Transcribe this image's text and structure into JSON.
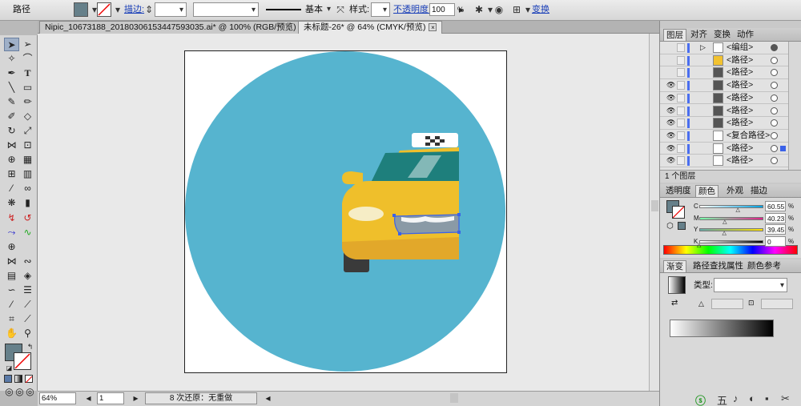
{
  "control_bar": {
    "object_type": "路径",
    "fill_color": "#66808a",
    "stroke_label": "描边:",
    "stroke_style_label": "基本",
    "style_label": "样式:",
    "opacity_label": "不透明度:",
    "opacity_value": "100",
    "opacity_unit": "%",
    "transform_link": "变换"
  },
  "doc_tabs": [
    {
      "label": "Nipic_10673188_20180306153447593035.ai* @ 100% (RGB/预览)",
      "active": false
    },
    {
      "label": "未标题-26* @ 64% (CMYK/预览)",
      "active": true
    }
  ],
  "tab_close": "×",
  "status_bar": {
    "zoom": "64%",
    "page": "1",
    "undo_info": "8 次还原：无重做"
  },
  "layers_panel": {
    "tabs": [
      "图层",
      "对齐",
      "变换",
      "动作"
    ],
    "rows": [
      {
        "name": "<编组>",
        "visible": false,
        "thumb": "#ffffff"
      },
      {
        "name": "<路径>",
        "visible": false,
        "thumb": "#f2c230"
      },
      {
        "name": "<路径>",
        "visible": false,
        "thumb": "#555555"
      },
      {
        "name": "<路径>",
        "visible": true,
        "thumb": "#555555"
      },
      {
        "name": "<路径>",
        "visible": true,
        "thumb": "#555555"
      },
      {
        "name": "<路径>",
        "visible": true,
        "thumb": "#555555"
      },
      {
        "name": "<路径>",
        "visible": true,
        "thumb": "#555555"
      },
      {
        "name": "<复合路径>",
        "visible": true,
        "thumb": "#ffffff"
      },
      {
        "name": "<路径>",
        "visible": true,
        "thumb": "#ffffff",
        "selected": true
      },
      {
        "name": "<路径>",
        "visible": true,
        "thumb": "#ffffff"
      }
    ],
    "footer_label": "1 个图层"
  },
  "color_panel": {
    "tabs": [
      "透明度",
      "颜色",
      "外观",
      "描边"
    ],
    "channels": [
      {
        "label": "C",
        "value": "60.55",
        "level": 0.6055,
        "gradient": "linear-gradient(90deg,#fff,#00a0e0)"
      },
      {
        "label": "M",
        "value": "40.23",
        "level": 0.4023,
        "gradient": "linear-gradient(90deg,#7fa,#e0208a)"
      },
      {
        "label": "Y",
        "value": "39.45",
        "level": 0.3945,
        "gradient": "linear-gradient(90deg,#6aa,#ffe000)"
      },
      {
        "label": "K",
        "value": "0",
        "level": 0.0,
        "gradient": "linear-gradient(90deg,#fff,#000)"
      }
    ],
    "unit": "%"
  },
  "gradient_panel": {
    "tabs": [
      "渐变",
      "路径查找",
      "属性",
      "颜色参考"
    ],
    "type_label": "类型:"
  },
  "colors": {
    "circle": "#56b4cf",
    "taxi_body": "#efbf2b",
    "taxi_windshield": "#1e7f7c",
    "bumper": "#e2a82a",
    "tire": "#3a3a3a",
    "grille": "#8a9aa6",
    "headlight": "#f6edc6"
  }
}
